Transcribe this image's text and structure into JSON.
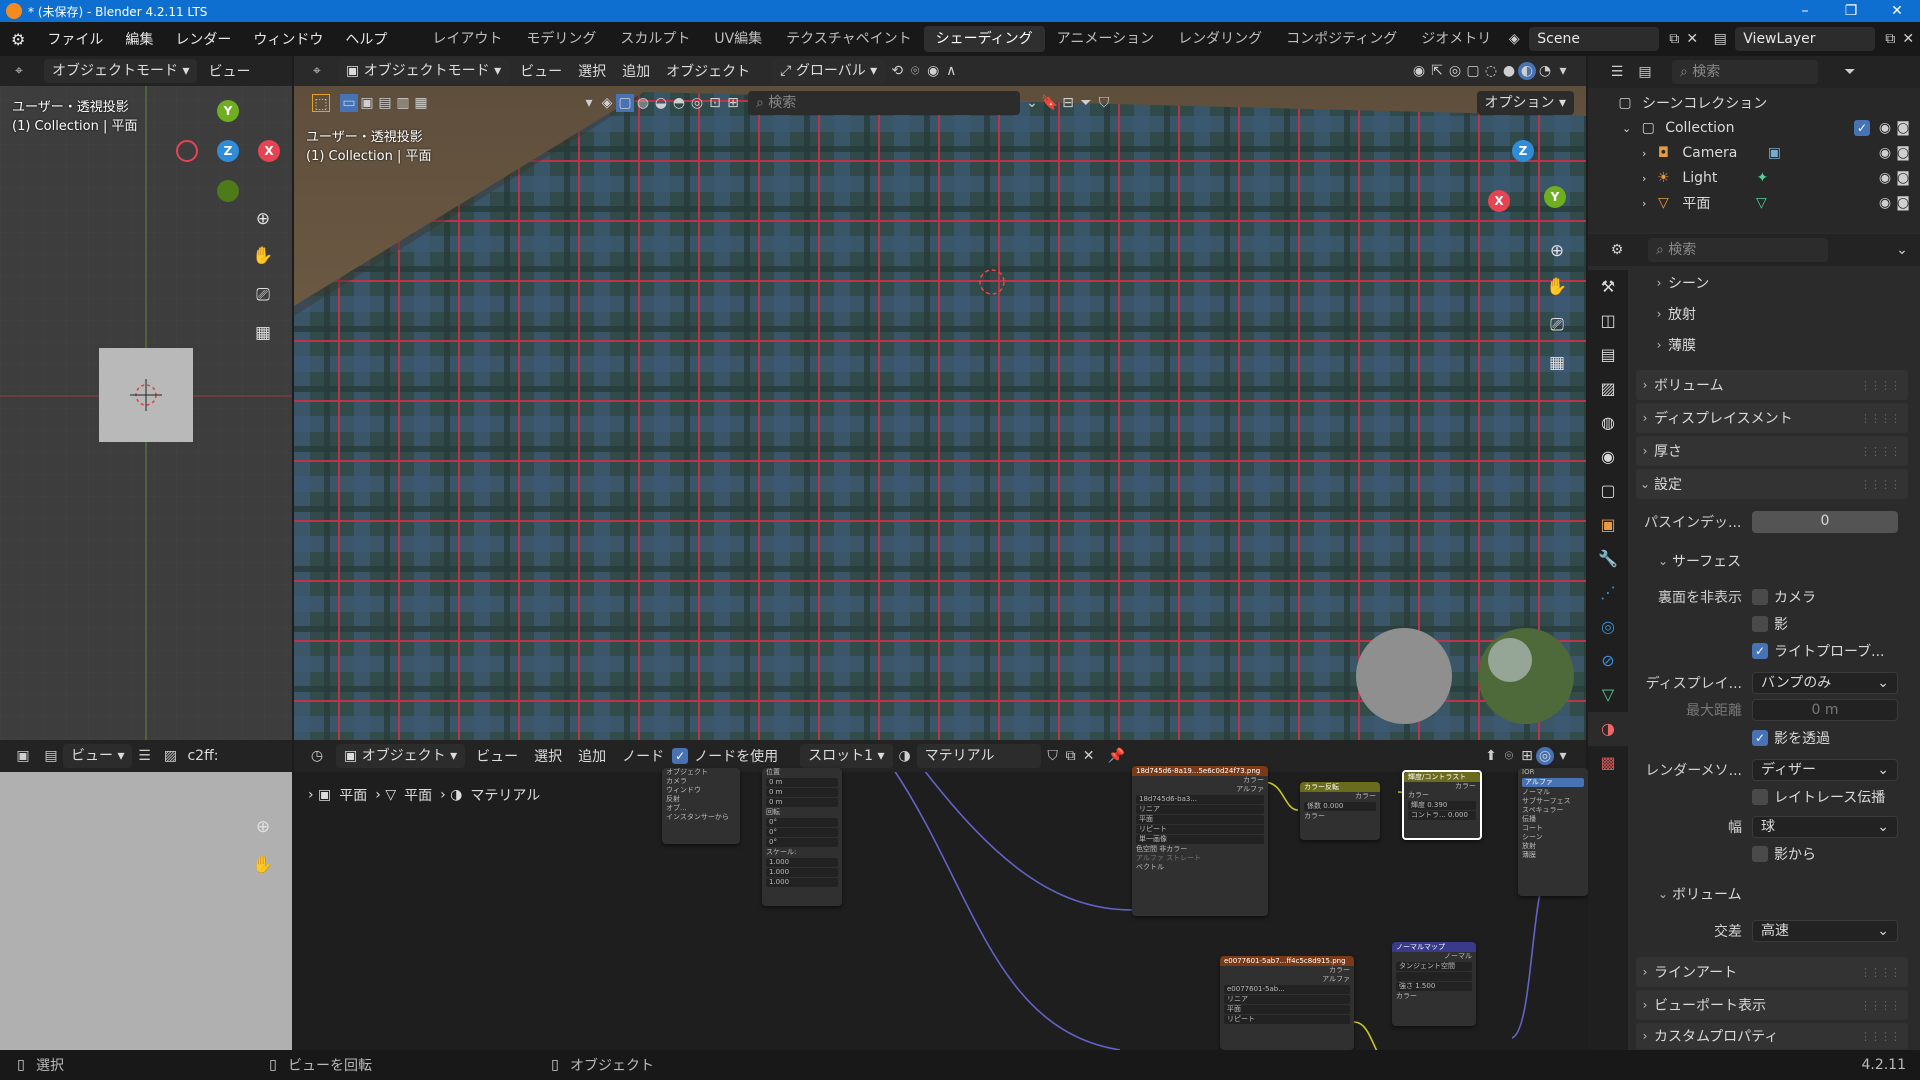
{
  "titlebar": {
    "title": "* (未保存) - Blender 4.2.11 LTS"
  },
  "menu": {
    "items": [
      "ファイル",
      "編集",
      "レンダー",
      "ウィンドウ",
      "ヘルプ"
    ]
  },
  "workspaces": [
    "レイアウト",
    "モデリング",
    "スカルプト",
    "UV編集",
    "テクスチャペイント",
    "シェーディング",
    "アニメーション",
    "レンダリング",
    "コンポジティング",
    "ジオメトリ"
  ],
  "scene": {
    "name": "Scene",
    "view_layer": "ViewLayer"
  },
  "left_view": {
    "mode": "オブジェクトモード",
    "view_menu": "ビュー",
    "overlay_line1": "ユーザー・透視投影",
    "overlay_line2": "(1) Collection | 平面"
  },
  "main_view": {
    "mode": "オブジェクトモード",
    "menus": [
      "ビュー",
      "選択",
      "追加",
      "オブジェクト"
    ],
    "transform": "グローバル",
    "search_placeholder": "検索",
    "options": "オプション",
    "overlay_line1": "ユーザー・透視投影",
    "overlay_line2": "(1) Collection | 平面"
  },
  "image_editor": {
    "view_menu": "ビュー",
    "image_name": "c2ff:"
  },
  "node_editor": {
    "type": "オブジェクト",
    "menus": [
      "ビュー",
      "選択",
      "追加",
      "ノード"
    ],
    "use_nodes": "ノードを使用",
    "slot": "スロット1",
    "material": "マテリアル",
    "breadcrumb": [
      "平面",
      "平面",
      "マテリアル"
    ],
    "nodes": {
      "tex_node": {
        "title": "18d745d6-8a19...5e6c0d24f73.png",
        "image": "18d745d6-ba3...",
        "rows": [
          "カラー",
          "アルファ"
        ],
        "fields": [
          "リニア",
          "平面",
          "リピート",
          "単一画像"
        ],
        "colorspace_label": "色空間",
        "colorspace": "非カラー",
        "alpha_label": "アルファ",
        "alpha": "ストレート",
        "vector": "ベクトル"
      },
      "mix_node": {
        "title": "カラー反転",
        "rows": [
          "カラー",
          "係数",
          "カラー"
        ],
        "fac": "0.000"
      },
      "bc_node": {
        "title": "輝度/コントラスト",
        "rows": [
          "カラー",
          "カラー",
          "輝度",
          "コントラ..."
        ],
        "bright": "0.390",
        "contrast": "0.000"
      },
      "normal_tex": {
        "title": "e0077601-5ab7...ff4c5c8d915.png",
        "image": "e0077601-5ab...",
        "rows": [
          "カラー",
          "アルファ"
        ],
        "fields": [
          "リニア",
          "平面",
          "リピート"
        ]
      },
      "normal_map": {
        "title": "ノーマルマップ",
        "rows": [
          "ノーマル",
          "タンジェント空間",
          "強さ",
          "カラー"
        ],
        "strength": "1.500"
      },
      "mapping_node": {
        "rows": [
          "位置",
          "回転",
          "スケール:"
        ],
        "loc": [
          "0 m",
          "0 m",
          "0 m"
        ],
        "rot": [
          "0°",
          "0°",
          "0°"
        ],
        "scale": [
          "1.000",
          "1.000",
          "1.000"
        ]
      },
      "texcoord_node": {
        "rows": [
          "オブジェクト",
          "カメラ",
          "ウィンドウ",
          "反射",
          "オブ...",
          "インスタンサーから"
        ]
      },
      "bsdf_partial": {
        "rows": [
          "IOR",
          "アルファ",
          "ノーマル",
          "サブサーフェス",
          "スペキュラー",
          "伝播",
          "コート",
          "シーン",
          "放射",
          "薄膜"
        ]
      }
    }
  },
  "outliner": {
    "search_placeholder": "検索",
    "root": "シーンコレクション",
    "collection": "Collection",
    "items": [
      "Camera",
      "Light",
      "平面"
    ]
  },
  "properties": {
    "search_placeholder": "検索",
    "sections_top": [
      "シーン",
      "放射",
      "薄膜"
    ],
    "sections": [
      "ボリューム",
      "ディスプレイスメント",
      "厚さ"
    ],
    "settings": "設定",
    "pass_index_label": "パスインデッ...",
    "pass_index": "0",
    "surface": "サーフェス",
    "backface_label": "裏面を非表示",
    "camera": "カメラ",
    "shadow": "影",
    "light_probe": "ライトプローブ...",
    "displacement_label": "ディスプレイ...",
    "displacement": "バンプのみ",
    "max_dist_label": "最大距離",
    "max_dist": "0 m",
    "transparent_shadow": "影を透過",
    "render_method_label": "レンダーメソ...",
    "render_method": "ディザー",
    "raytrace": "レイトレース伝播",
    "width_label": "幅",
    "width": "球",
    "from_shadow": "影から",
    "volume": "ボリューム",
    "intersect_label": "交差",
    "intersect": "高速",
    "bottom_sections": [
      "ラインアート",
      "ビューポート表示",
      "カスタムプロパティ"
    ]
  },
  "statusbar": {
    "select": "選択",
    "rotate": "ビューを回転",
    "object": "オブジェクト",
    "version": "4.2.11"
  },
  "colors": {
    "accent": "#4772b3",
    "titlebar": "#0f6fd0",
    "x_axis": "#e64452",
    "y_axis": "#6fae20",
    "z_axis": "#2f8cd8"
  }
}
